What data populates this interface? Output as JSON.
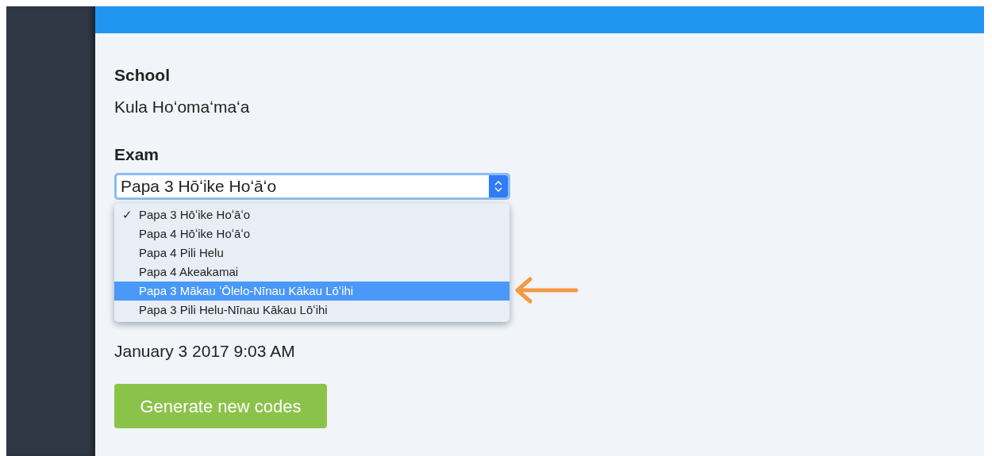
{
  "school": {
    "label": "School",
    "value": "Kula Hoʻomaʻmaʻa"
  },
  "exam": {
    "label": "Exam",
    "value": "Papa 3 Hōʻike Hoʻāʻo",
    "check_glyph": "✓",
    "options": [
      {
        "label": "Papa 3 Hōʻike Hoʻāʻo",
        "checked": true,
        "highlighted": false
      },
      {
        "label": "Papa 4 Hōʻike Hoʻāʻo",
        "checked": false,
        "highlighted": false
      },
      {
        "label": "Papa 4 Pili Helu",
        "checked": false,
        "highlighted": false
      },
      {
        "label": "Papa 4 Akeakamai",
        "checked": false,
        "highlighted": false
      },
      {
        "label": "Papa 3 Mākau ʻŌlelo-Nīnau Kākau Lōʻihi",
        "checked": false,
        "highlighted": true
      },
      {
        "label": "Papa 3 Pili Helu-Nīnau Kākau Lōʻihi",
        "checked": false,
        "highlighted": false
      }
    ]
  },
  "date": "January 3 2017 9:03 AM",
  "button": "Generate new codes"
}
